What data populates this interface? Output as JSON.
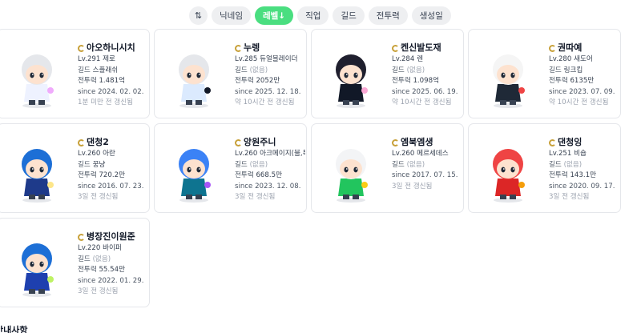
{
  "sort_bar": {
    "toggle_icon": "⇅",
    "buttons": [
      {
        "label": "닉네임",
        "active": false
      },
      {
        "label": "레벨↓",
        "active": true
      },
      {
        "label": "직업",
        "active": false
      },
      {
        "label": "길드",
        "active": false
      },
      {
        "label": "전투력",
        "active": false
      },
      {
        "label": "생성일",
        "active": false
      }
    ]
  },
  "labels": {
    "guild_prefix": "길드",
    "power_prefix": "전투력",
    "since_prefix": "since"
  },
  "characters": [
    {
      "name": "아오하니시치",
      "level": "Lv.291",
      "job": "제로",
      "guild": "스플래쉬",
      "guild_none": false,
      "power": "1.481억",
      "since": "2024. 02. 02.",
      "updated": "1분 미만 전 갱신됨",
      "colors": {
        "hair": "#e5e7eb",
        "outfit": "#eef2ff",
        "accent": "#f0abfc"
      }
    },
    {
      "name": "누렝",
      "level": "Lv.285",
      "job": "듀얼블레이더",
      "guild": "(없음)",
      "guild_none": true,
      "power": "2052만",
      "since": "2025. 12. 18.",
      "updated": "약 10시간 전 갱신됨",
      "colors": {
        "hair": "#e5e7eb",
        "outfit": "#dbeafe",
        "accent": "#111827"
      }
    },
    {
      "name": "켄신발도재",
      "level": "Lv.284",
      "job": "렌",
      "guild": "(없음)",
      "guild_none": true,
      "power": "1.098억",
      "since": "2025. 06. 19.",
      "updated": "약 10시간 전 갱신됨",
      "colors": {
        "hair": "#1f1f2e",
        "outfit": "#111827",
        "accent": "#f9a8d4"
      }
    },
    {
      "name": "권따예",
      "level": "Lv.280",
      "job": "새도어",
      "guild": "링크킵",
      "guild_none": false,
      "power": "6135만",
      "since": "2023. 07. 09.",
      "updated": "약 10시간 전 갱신됨",
      "colors": {
        "hair": "#f5f5f5",
        "outfit": "#1f2937",
        "accent": "#ef4444"
      }
    },
    {
      "name": "댄청2",
      "level": "Lv.260",
      "job": "아란",
      "guild": "꿍냥",
      "guild_none": false,
      "power": "720.2만",
      "since": "2016. 07. 23.",
      "updated": "3일 전 갱신됨",
      "colors": {
        "hair": "#1d6fd6",
        "outfit": "#1e3a8a",
        "accent": "#fde68a"
      }
    },
    {
      "name": "앙원주니",
      "level": "Lv.260",
      "job": "아크메이지(불,독)",
      "guild": "(없음)",
      "guild_none": true,
      "power": "668.5만",
      "since": "2023. 12. 08.",
      "updated": "3일 전 갱신됨",
      "colors": {
        "hair": "#3b82f6",
        "outfit": "#0e7490",
        "accent": "#a855f7"
      }
    },
    {
      "name": "엠북엠생",
      "level": "Lv.260",
      "job": "메르세데스",
      "guild": "(없음)",
      "guild_none": true,
      "power": "",
      "since": "2017. 07. 15.",
      "updated": "3일 전 갱신됨",
      "colors": {
        "hair": "#f3f4f6",
        "outfit": "#22c55e",
        "accent": "#facc15"
      }
    },
    {
      "name": "댄청잉",
      "level": "Lv.251",
      "job": "비숍",
      "guild": "(없음)",
      "guild_none": true,
      "power": "143.1만",
      "since": "2020. 09. 17.",
      "updated": "3일 전 갱신됨",
      "colors": {
        "hair": "#ef4444",
        "outfit": "#dc2626",
        "accent": "#f59e0b"
      }
    },
    {
      "name": "병장진이원준",
      "level": "Lv.220",
      "job": "바이퍼",
      "guild": "(없음)",
      "guild_none": true,
      "power": "55.54만",
      "since": "2022. 01. 29.",
      "updated": "3일 전 갱신됨",
      "colors": {
        "hair": "#1d6fd6",
        "outfit": "#1e40af",
        "accent": "#bef264"
      }
    }
  ],
  "footer": {
    "text": "안내사항"
  }
}
